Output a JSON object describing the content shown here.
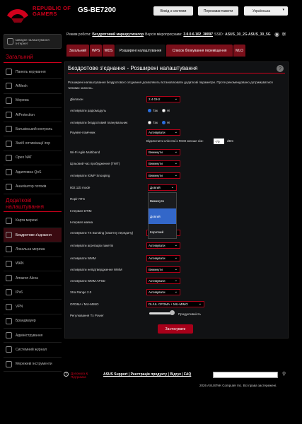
{
  "header": {
    "brand_line1": "REPUBLIC OF",
    "brand_line2": "GAMERS",
    "model": "GS-BE7200",
    "logout": "Вихід з системи",
    "reboot": "Перезавантажити",
    "language": "Українська"
  },
  "topbar": {
    "mode_label": "Режим роботи:",
    "mode_value": "Бездротовий маршрутизатор",
    "fw_label": "Версія мікропрограми:",
    "fw_value": "3.0.0.6.102_38097",
    "ssid_label": "SSID:",
    "mac": "ASUS_30_2G ASUS_30_5G"
  },
  "sidebar": {
    "setup": "Швидке налаштування Інтернет",
    "general_title": "Загальний",
    "general_items": [
      "Панель керування",
      "AiMesh",
      "Мережа",
      "AiProtection",
      "Батьківський контроль",
      "Засіб оптимізації ігор",
      "Open NAT",
      "Адаптивна QoS",
      "Аналізатор потоків"
    ],
    "advanced_title": "Додаткові налаштування",
    "advanced_items": [
      "Карта мережі",
      "Бездротове з'єднання",
      "Локальна мережа",
      "WAN",
      "Amazon Alexa",
      "IPv6",
      "VPN",
      "Брандмауер",
      "Адміністрування",
      "Системний журнал",
      "Мережеві інструменти"
    ]
  },
  "tabs": [
    "Загальний",
    "WPS",
    "WDS",
    "Розширені налаштування",
    "Список блокування переміщення",
    "MLO"
  ],
  "panel": {
    "title": "Бездротове з'єднання - Розширені налаштування",
    "help": "?",
    "description": "Розширені налаштування бездротового з'єднання дозволяють встановлювати додаткові параметри. Проте рекомендовано дотримуватися типових значень.",
    "rows": [
      {
        "label": "Діапазон",
        "value": "2.4 GHz"
      },
      {
        "label": "Активувати радіомодуль"
      },
      {
        "label": "Активувати бездротовий планувальник"
      },
      {
        "label": "Роумінг-помічник",
        "value": "Активувати"
      },
      {
        "label": "Wi-Fi Agile Multiband",
        "value": "Вимкнути"
      },
      {
        "label": "Цільовий час пробудження (TWT)",
        "value": "Вимкнути"
      },
      {
        "label": "Активувати IGMP Snooping",
        "value": "Вимкнути"
      },
      {
        "label": "802.11b mode",
        "value": "Довгий"
      },
      {
        "label": "Поріг RTS"
      },
      {
        "label": "Інтервал DTIM"
      },
      {
        "label": "Інтервал маяка"
      },
      {
        "label": "Активувати TX Bursting (пакетну передачу)",
        "value": "Активувати"
      },
      {
        "label": "Активувати агрегацію пакетів",
        "value": "Активувати"
      },
      {
        "label": "Активувати WMM",
        "value": "Активувати"
      },
      {
        "label": "Активувати непідтвердження WMM",
        "value": "Вимкнути"
      },
      {
        "label": "Активувати WMM APSD",
        "value": "Активувати"
      },
      {
        "label": "Xtra Range 2.0",
        "value": "Активувати"
      },
      {
        "label": "OFDMA / MU-MIMO",
        "value": "DL/UL OFDMA + MU-MIMO"
      },
      {
        "label": "Регулювання Tx Power"
      }
    ],
    "radio_yes": "Так",
    "radio_no": "Ні",
    "rssi_label": "Відключити клієнта із RSSI менше ніж:",
    "rssi_value": "-70",
    "rssi_unit": "dBm",
    "dropdown_options": [
      "Вимкнути",
      "Довгий",
      "Короткий"
    ],
    "power_label": "Продуктивність",
    "power_level": 0.9,
    "apply": "Застосувати"
  },
  "footer": {
    "help_line1": "Допомога &",
    "help_line2": "Підтримка",
    "links": "ASUS Support | Реєстрація продукту | Відгук | FAQ",
    "copyright": "2026 ASUSTeK Computer Inc. Всі права застережені."
  },
  "colors": {
    "accent": "#d0001c",
    "selected": "#3367c9"
  }
}
